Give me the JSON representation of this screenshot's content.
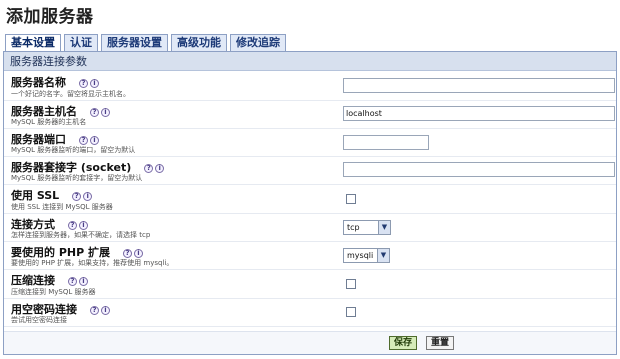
{
  "page": {
    "title": "添加服务器"
  },
  "tabs": [
    {
      "label": "基本设置",
      "active": true
    },
    {
      "label": "认证",
      "active": false
    },
    {
      "label": "服务器设置",
      "active": false
    },
    {
      "label": "高级功能",
      "active": false
    },
    {
      "label": "修改追踪",
      "active": false
    }
  ],
  "section": {
    "title": "服务器连接参数"
  },
  "fields": [
    {
      "label": "服务器名称",
      "desc": "一个好记的名字。留空将显示主机名。",
      "value": ""
    },
    {
      "label": "服务器主机名",
      "desc": "MySQL 服务器的主机名",
      "value": "localhost"
    },
    {
      "label": "服务器端口",
      "desc": "MySQL 服务器监听的端口，留空为默认",
      "value": ""
    },
    {
      "label": "服务器套接字 (socket)",
      "desc": "MySQL 服务器监听的套接字，留空为默认",
      "value": ""
    },
    {
      "label": "使用 SSL",
      "desc": "使用 SSL 连接到 MySQL 服务器",
      "checked": false
    },
    {
      "label": "连接方式",
      "desc": "怎样连接到服务器，如果不确定，请选择 tcp",
      "selected": "tcp"
    },
    {
      "label": "要使用的 PHP 扩展",
      "desc": "要使用的 PHP 扩展，如果支持，推荐使用 mysqli。",
      "selected": "mysqli"
    },
    {
      "label": "压缩连接",
      "desc": "压缩连接到 MySQL 服务器",
      "checked": false
    },
    {
      "label": "用空密码连接",
      "desc": "尝试用空密码连接",
      "checked": false
    }
  ],
  "icons": {
    "help": "?",
    "info": "i"
  },
  "buttons": {
    "save": "保存",
    "reset": "重置"
  },
  "colors": {
    "tab_border": "#8da0c4",
    "header_bg": "#d7e0ee",
    "save_bg": "#d6ecb9"
  }
}
